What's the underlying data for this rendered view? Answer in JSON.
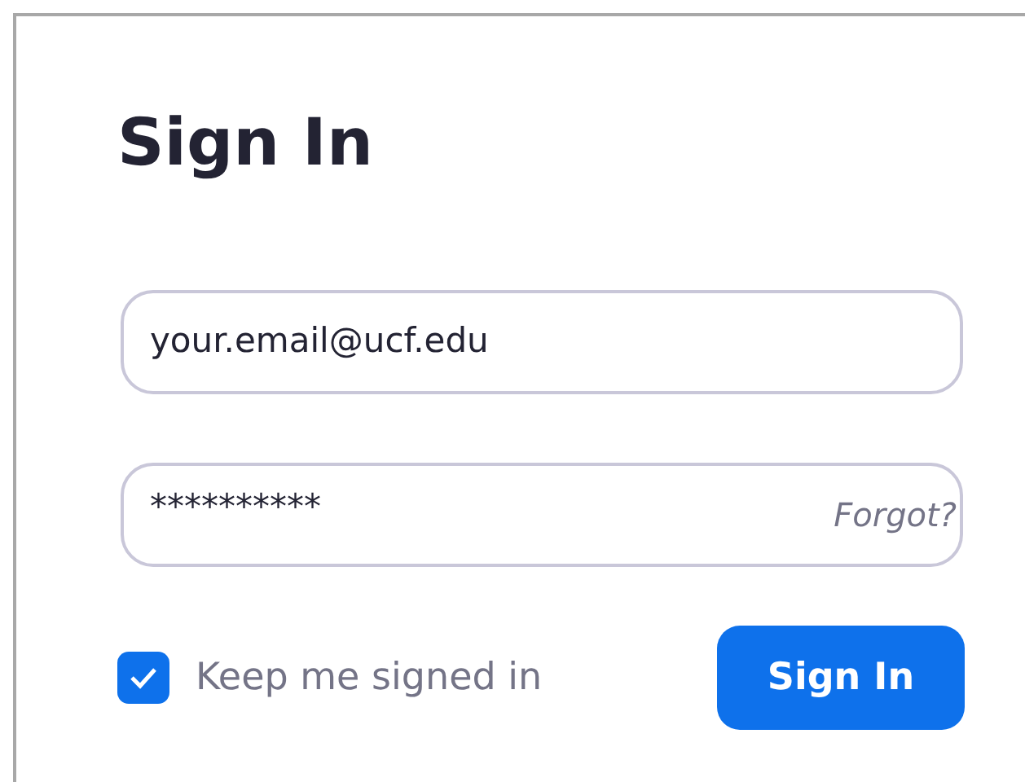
{
  "title": "Sign In",
  "email": {
    "value": "your.email@ucf.edu"
  },
  "password": {
    "value": "**********",
    "link": "Forgot?"
  },
  "keep_signed_in": {
    "label": "Keep me signed in",
    "checked": true
  },
  "submit": {
    "label": "Sign In"
  }
}
